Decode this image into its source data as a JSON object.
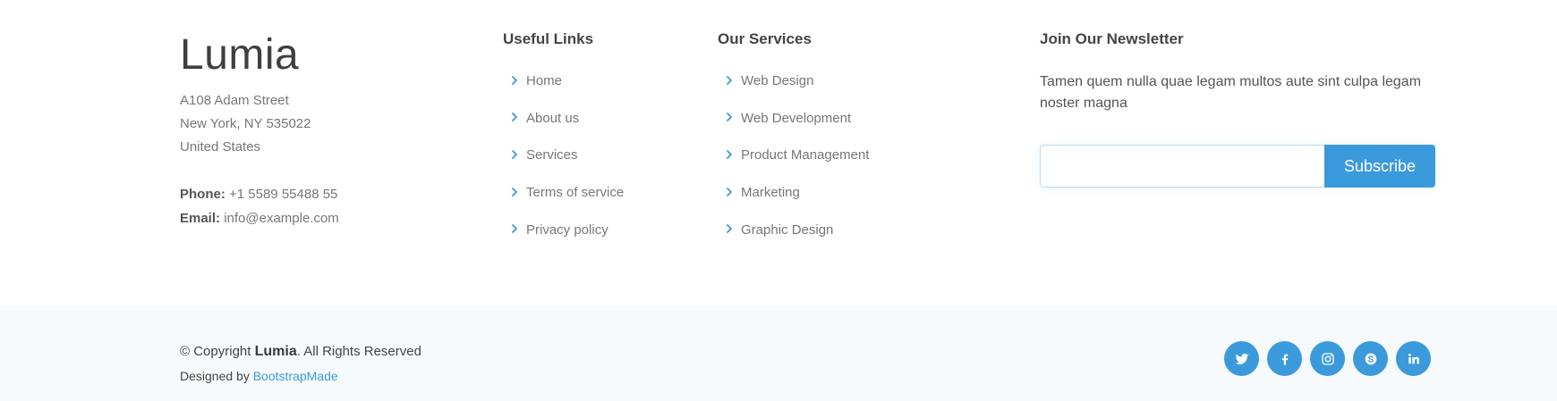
{
  "brand": {
    "name": "Lumia"
  },
  "address": {
    "line1": "A108 Adam Street",
    "line2": "New York, NY 535022",
    "line3": "United States"
  },
  "contact": {
    "phone_label": "Phone:",
    "phone_value": "+1 5589 55488 55",
    "email_label": "Email:",
    "email_value": "info@example.com"
  },
  "useful_links": {
    "title": "Useful Links",
    "items": [
      {
        "label": "Home"
      },
      {
        "label": "About us"
      },
      {
        "label": "Services"
      },
      {
        "label": "Terms of service"
      },
      {
        "label": "Privacy policy"
      }
    ]
  },
  "services": {
    "title": "Our Services",
    "items": [
      {
        "label": "Web Design"
      },
      {
        "label": "Web Development"
      },
      {
        "label": "Product Management"
      },
      {
        "label": "Marketing"
      },
      {
        "label": "Graphic Design"
      }
    ]
  },
  "newsletter": {
    "title": "Join Our Newsletter",
    "text": "Tamen quem nulla quae legam multos aute sint culpa legam noster magna",
    "input_value": "",
    "button_label": "Subscribe"
  },
  "footer": {
    "copyright_prefix": "© Copyright ",
    "copyright_brand": "Lumia",
    "copyright_suffix": ". All Rights Reserved",
    "designed_by_prefix": "Designed by ",
    "designed_by_link": "BootstrapMade"
  },
  "social_icons": [
    "twitter-icon",
    "facebook-icon",
    "instagram-icon",
    "skype-icon",
    "linkedin-icon"
  ],
  "colors": {
    "accent": "#3b9adb",
    "bottom_background": "#f6fafd",
    "heading": "#444444",
    "muted_text": "#777777"
  }
}
